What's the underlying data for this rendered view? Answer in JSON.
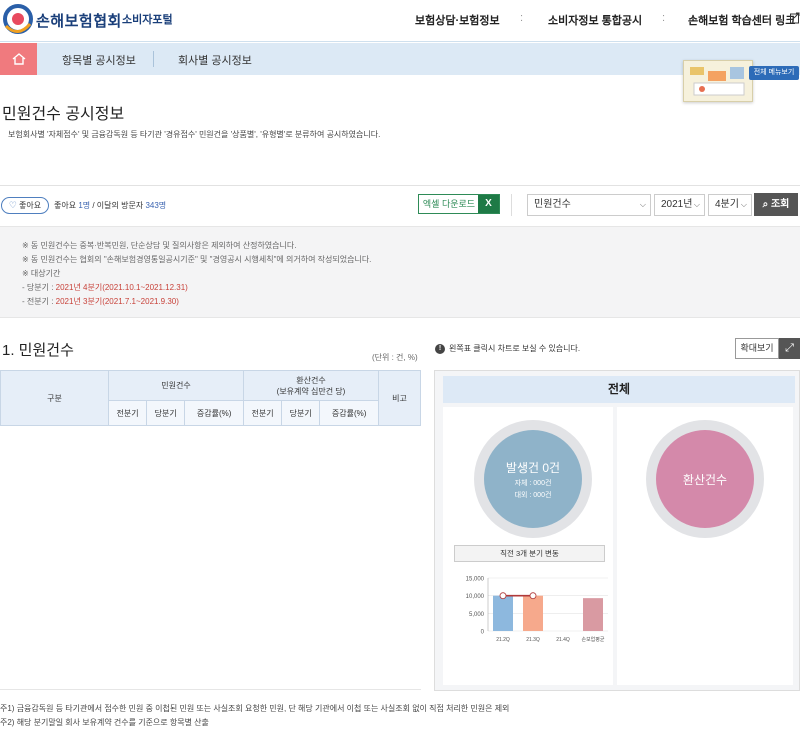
{
  "header": {
    "brand": "손해보험협회",
    "brand_sub": "소비자포털",
    "gnb": [
      "보험상담·보험정보",
      "소비자정보 통합공시",
      "손해보험 학습센터 링크"
    ]
  },
  "subnav": {
    "items": [
      "항목별 공시정보",
      "회사별 공시정보"
    ],
    "menu_badge": "전체 메뉴보기"
  },
  "page": {
    "title": "민원건수 공시정보",
    "desc": "보험회사별 '자체접수' 및 금융감독원 등 타기관 '경유접수' 민원건을 '상품별', '유형별'로 분류하여 공시하였습니다."
  },
  "like": {
    "button": "좋아요",
    "label": "좋아요",
    "likes": "1명",
    "sep": " / 이달의 방문자",
    "visitors": "343명"
  },
  "toolbar": {
    "excel": "엑셀 다운로드",
    "excel_icon": "X",
    "select_type": "민원건수",
    "select_year": "2021년",
    "select_quarter": "4분기",
    "search": "조회"
  },
  "notice": {
    "l1": "※ 동 민원건수는 중복·반복민원, 단순상담 및 질의사항은 제외하여 산정하였습니다.",
    "l2": "※ 동 민원건수는 협회의 \"손해보험경영통일공시기준\" 및 \"경영공시 시행세칙\"에 의거하여 작성되었습니다.",
    "l3": "※ 대상기간",
    "l4_label": "- 당분기 : ",
    "l4_value": "2021년 4분기(2021.10.1~2021.12.31)",
    "l5_label": "- 전분기 : ",
    "l5_value": "2021년 3분기(2021.7.1~2021.9.30)"
  },
  "section": {
    "title": "1. 민원건수",
    "unit": "(단위 : 건, %)",
    "info": "왼쪽표 클릭시 차트로 보실 수 있습니다.",
    "zoom": "확대보기"
  },
  "table": {
    "h_gubun": "구분",
    "h_minwon": "민원건수",
    "h_hwansan": "환산건수",
    "h_hwansan_sub": "(보유계약 십만건 당)",
    "h_bigo": "비고",
    "sub": [
      "전분기",
      "당분기",
      "증감률(%)",
      "전분기",
      "당분기",
      "증감률(%)"
    ]
  },
  "panel": {
    "head": "전체",
    "left_big": "발생건 0건",
    "left_self": "자체 : 000건",
    "left_other": "대외 : 000건",
    "right_big": "환산건수",
    "trend": "직전 3개 분기 변동"
  },
  "chart_data": {
    "type": "bar",
    "categories": [
      "21.2Q",
      "21.3Q",
      "21.4Q",
      "손보업평균"
    ],
    "series": [
      {
        "values": [
          10000,
          10000,
          0,
          9300
        ],
        "colors": [
          "#8db8de",
          "#f6a98c",
          "#cccccc",
          "#d99aa2"
        ]
      }
    ],
    "line": {
      "values": [
        10000,
        10000
      ]
    },
    "yticks": [
      "15,000",
      "10,000",
      "5,000",
      "0"
    ],
    "ylim": [
      0,
      15000
    ]
  },
  "footnotes": [
    "주1) 금융감독원 등 타기관에서 접수한 민원 중 이첩된 민원 또는 사실조회 요청한 민원, 단 해당 기관에서 이첩 또는 사실조회 없이 직접 처리한 민원은 제외",
    "주2) 해당 분기말일 회사 보유계약 건수를 기준으로 항목별 산출"
  ]
}
